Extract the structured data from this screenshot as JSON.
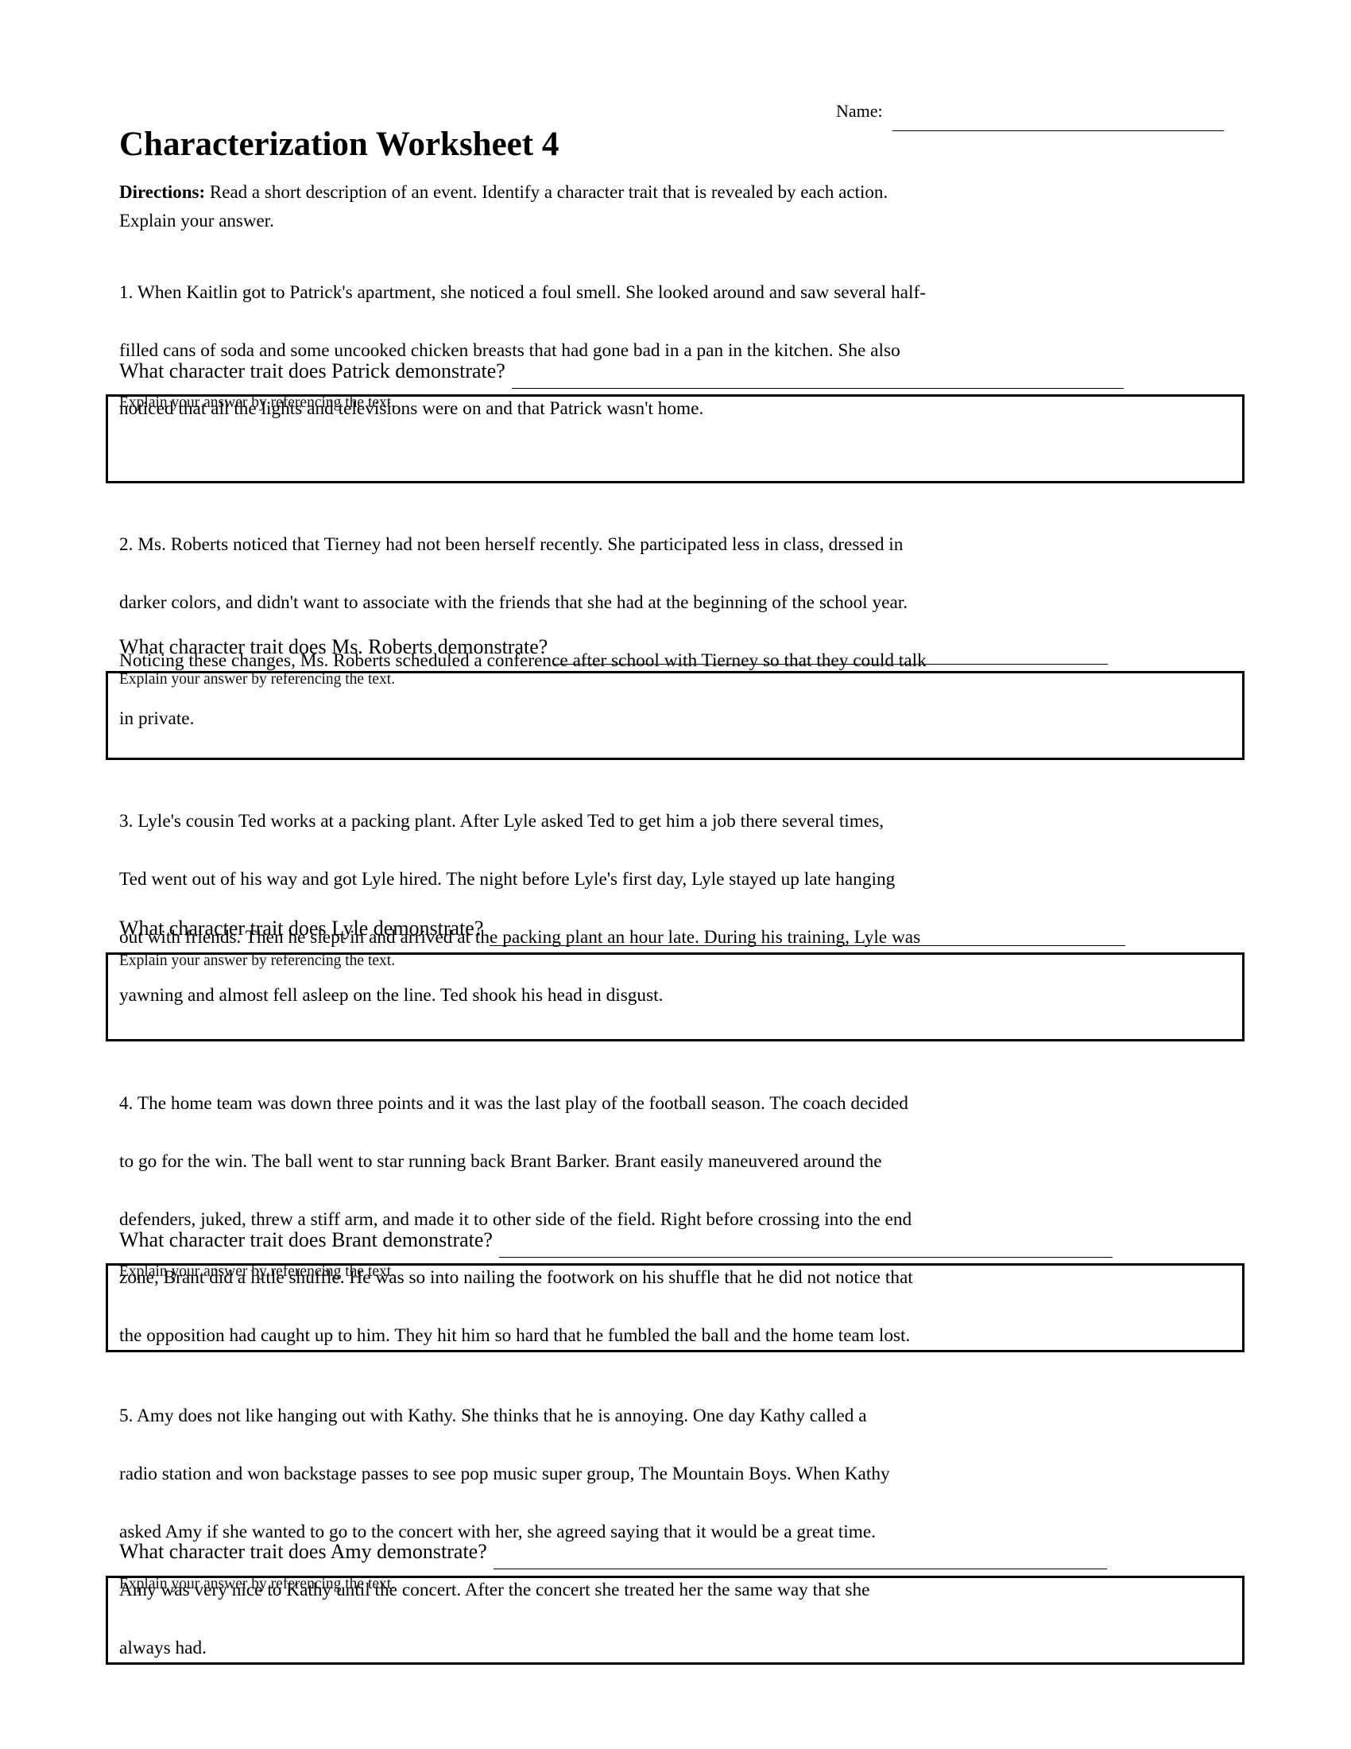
{
  "header": {
    "name_label": "Name:",
    "title": "Characterization Worksheet 4",
    "directions_label": "Directions:",
    "directions_text": " Read a short description of an event.  Identify a character trait that is revealed by each action.",
    "directions_text_2": "Explain your answer."
  },
  "explain_label": "Explain your answer by referencing the text.",
  "questions": [
    {
      "number": "1.",
      "lines": [
        "1. When Kaitlin got to Patrick's apartment, she noticed a foul smell. She looked around and saw several half-",
        "filled cans of soda and some uncooked chicken breasts that had gone bad in a pan in the kitchen.  She also",
        "noticed that all the lights and televisions were on and that Patrick wasn't home."
      ],
      "prompt": "What character trait does Patrick demonstrate?",
      "answer": ""
    },
    {
      "number": "2.",
      "lines": [
        "2.  Ms. Roberts noticed that Tierney had not been herself recently.  She participated less in class, dressed in",
        "darker colors, and didn't want to associate with the friends that she had at the beginning of the school year.",
        "Noticing these changes, Ms. Roberts scheduled a conference after school with Tierney so that they could talk",
        "in private."
      ],
      "prompt": "What character trait does Ms. Roberts demonstrate?",
      "answer": ""
    },
    {
      "number": "3.",
      "lines": [
        "3.  Lyle's cousin Ted works at a packing plant.  After Lyle asked Ted to get him a job there several times,",
        "Ted went out of his way and got Lyle hired.  The night before Lyle's first day, Lyle stayed up late hanging",
        "out with friends.  Then he slept in and arrived at the packing plant an hour late. During his training, Lyle was",
        "yawning and almost fell asleep on the line.  Ted shook his head in disgust."
      ],
      "prompt": "What character trait does Lyle demonstrate?",
      "answer": ""
    },
    {
      "number": "4.",
      "lines": [
        "4.  The home team was down three points and it was the last play of the football season. The coach decided",
        "to go for the win. The ball went to star running back Brant Barker. Brant easily maneuvered around the",
        "defenders, juked, threw a stiff arm, and made it to other side of the field. Right before crossing into the end",
        "zone, Brant did a little shuffle. He was so into nailing the footwork on his shuffle that he did not notice that",
        "the opposition had caught up to him. They hit him so hard that he fumbled the ball and the home team lost."
      ],
      "prompt": "What character trait does Brant demonstrate?",
      "answer": ""
    },
    {
      "number": "5.",
      "lines": [
        "5.  Amy does not like hanging out with Kathy.  She thinks that he is annoying.  One day Kathy called a",
        "radio station and won backstage passes to see pop music super group, The Mountain Boys.  When Kathy",
        "asked Amy if she wanted to go to the concert with her, she agreed saying that it would be a great time.",
        "Amy was very nice to Kathy until the concert.  After the concert she treated her the same way that she",
        "always had."
      ],
      "prompt": "What character trait does Amy demonstrate?",
      "answer": ""
    }
  ]
}
